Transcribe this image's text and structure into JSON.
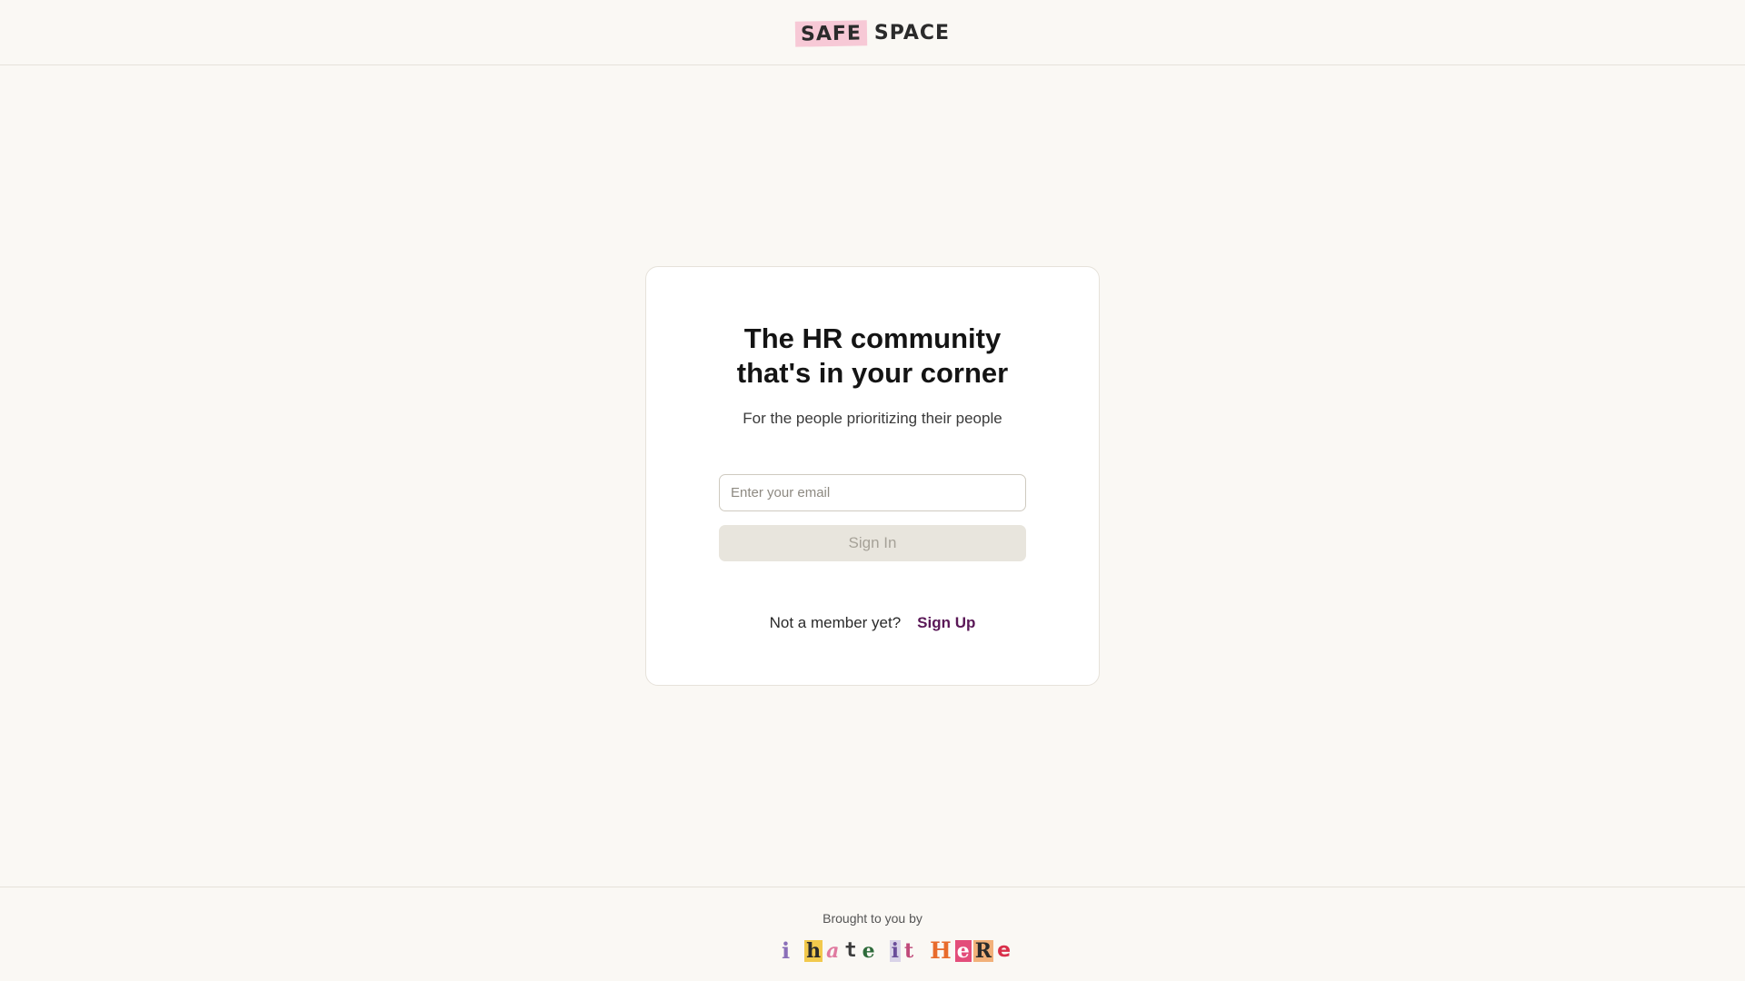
{
  "header": {
    "logo_word1": "SAFE",
    "logo_word2": "SPACE"
  },
  "card": {
    "headline_line1": "The HR community",
    "headline_line2": "that's in your corner",
    "subline": "For the people prioritizing their people",
    "email_placeholder": "Enter your email",
    "email_value": "",
    "signin_label": "Sign In",
    "member_question": "Not a member yet?",
    "signup_label": "Sign Up"
  },
  "footer": {
    "brought_by": "Brought to you by",
    "brand_text": "i hate it HeRe"
  },
  "colors": {
    "background": "#faf8f4",
    "logo_highlight": "#f7c9d6",
    "signup_link": "#5a1857",
    "button_disabled_bg": "#e8e5dd"
  }
}
